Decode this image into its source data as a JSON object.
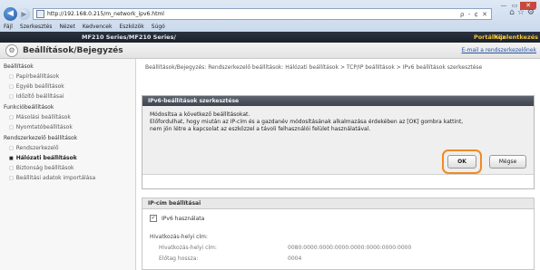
{
  "browser": {
    "url": "http://192.168.0.215/m_network_ipv6.html",
    "addr_tools": "ρ - ¢ ✕",
    "win_controls": [
      "—",
      "▭",
      "✕"
    ],
    "menu": [
      "Fájl",
      "Szerkesztés",
      "Nézet",
      "Kedvencek",
      "Eszközök",
      "Súgó"
    ]
  },
  "header": {
    "model": "MF210 Series/MF210 Series/",
    "portal": "Portálhoz",
    "logout": "Kijelentkezés"
  },
  "title": {
    "text": "Beállítások/Bejegyzés",
    "mail_link": "E-mail a rendszerkezelőnek"
  },
  "sidebar": {
    "section1": "Beállítások",
    "items1": [
      "Papírbeállítások",
      "Egyéb beállítások",
      "Időzítő beállításai"
    ],
    "section2": "Funkcióbeállítások",
    "items2": [
      "Másolási beállítások",
      "Nyomtatóbeállítások"
    ],
    "section3": "Rendszerkezelő beállítások",
    "items3": [
      "Rendszerkezelő",
      "Hálózati beállítások",
      "Biztonság beállítások",
      "Beállítási adatok importálása"
    ]
  },
  "breadcrumb": "Beállítások/Bejegyzés: Rendszerkezelő beállítások: Hálózati beállítások > TCP/IP beállítások > IPv6 beállítások szerkesztése",
  "dialog": {
    "title": "IPv6-beállítások szerkesztése",
    "line1": "Módosítsa a következő beállításokat.",
    "line2": "Előfordulhat, hogy miután az IP-cím és a gazdanév módosításának alkalmazása érdekében az [OK] gombra kattint,",
    "line3": "nem jön létre a kapcsolat az eszközzel a távoli felhasználói felület használatával.",
    "ok": "OK",
    "cancel": "Mégse"
  },
  "section": {
    "title": "IP-cím beállításai",
    "checkbox_label": "IPv6 használata",
    "checkbox_checked": true,
    "link_local_heading": "Hivatkozás-helyi cím:",
    "rows": [
      {
        "label": "Hivatkozás-helyi cím:",
        "value": "0080:0000:0000:0000:0000:0000:0000:0000"
      },
      {
        "label": "Előtag hossza:",
        "value": "0004"
      }
    ]
  }
}
